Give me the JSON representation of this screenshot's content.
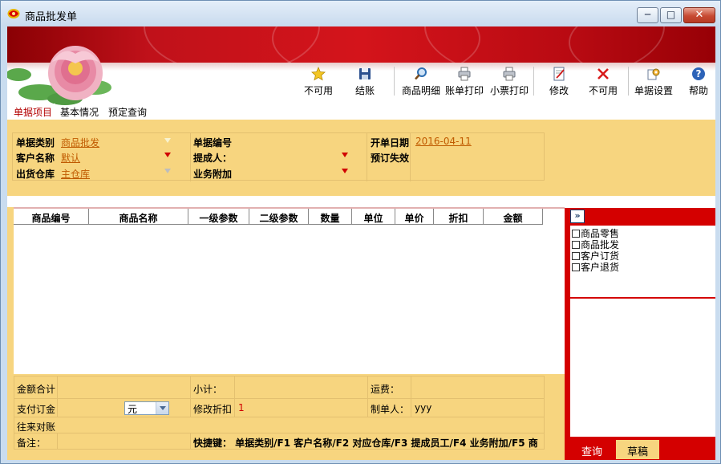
{
  "window": {
    "title": "商品批发单",
    "minimize": "─",
    "maximize": "□",
    "close": "✕"
  },
  "colors": {
    "banner_red": "#d4141b",
    "panel_yellow": "#f7d57f",
    "link_orange": "#c05a00",
    "accent_red": "#d40000"
  },
  "toolbar": {
    "items": [
      {
        "label": "不可用",
        "icon": "star-icon"
      },
      {
        "label": "结账",
        "icon": "save-disk-icon"
      },
      {
        "label": "商品明细",
        "icon": "magnifier-icon"
      },
      {
        "label": "账单打印",
        "icon": "printer-icon"
      },
      {
        "label": "小票打印",
        "icon": "printer-icon"
      },
      {
        "label": "修改",
        "icon": "edit-document-icon"
      },
      {
        "label": "不可用",
        "icon": "red-x-icon"
      },
      {
        "label": "单据设置",
        "icon": "settings-icon"
      },
      {
        "label": "帮助",
        "icon": "help-icon"
      }
    ]
  },
  "tabs": [
    "单据项目",
    "基本情况",
    "预定查询"
  ],
  "form": {
    "doc_type_label": "单据类别",
    "doc_type_value": "商品批发",
    "customer_label": "客户名称",
    "customer_value": "默认",
    "warehouse_label": "出货仓库",
    "warehouse_value": "主仓库",
    "doc_no_label": "单据编号",
    "doc_no_value": "",
    "proposer_label": "提成人：",
    "extra_label": "业务附加",
    "date_label": "开单日期",
    "date_value": "2016-04-11",
    "expire_label": "预订失效"
  },
  "grid": {
    "columns": [
      "商品编号",
      "商品名称",
      "一级参数",
      "二级参数",
      "数量",
      "单位",
      "单价",
      "折扣",
      "金额"
    ]
  },
  "summary": {
    "total_label": "金额合计",
    "subtotal_label": "小计：",
    "freight_label": "运费：",
    "deposit_label": "支付订金",
    "currency_value": "元",
    "discount_label": "修改折扣",
    "discount_value": "1",
    "maker_label": "制单人：",
    "maker_value": "yyy",
    "account_label": "往来对账",
    "remark_label": "备注：",
    "shortcut_text": "快捷键：  单据类别/F1  客户名称/F2  对应仓库/F3  提成员工/F4  业务附加/F5  商"
  },
  "right_panel": {
    "expand_label": "»",
    "options": [
      "商品零售",
      "商品批发",
      "客户订货",
      "客户退货"
    ],
    "tab_query": "查询",
    "tab_draft": "草稿"
  }
}
